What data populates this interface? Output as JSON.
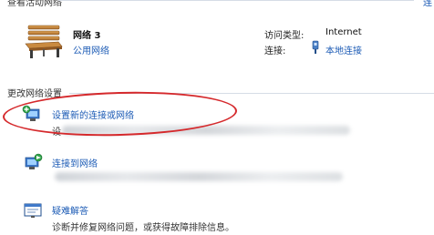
{
  "header": {
    "title": "查看活动网络",
    "right_link": "连"
  },
  "network": {
    "name": "网络  3",
    "type": "公用网络",
    "access_type_label": "访问类型:",
    "access_type_value": "Internet",
    "connections_label": "连接:",
    "connections_value": "本地连接"
  },
  "change_settings": {
    "title": "更改网络设置",
    "tasks": [
      {
        "label": "设置新的连接或网络",
        "desc_prefix": "设"
      },
      {
        "label": "连接到网络"
      },
      {
        "label": "疑难解答",
        "desc": "诊断并修复网络问题，或获得故障排除信息。"
      }
    ]
  },
  "icons": {
    "network": "bench-icon",
    "connection": "network-adapter-icon",
    "task1": "new-connection-icon",
    "task2": "connect-network-icon",
    "task3": "troubleshoot-icon"
  },
  "colors": {
    "link": "#1c5bb5",
    "highlight_ellipse": "#d5292c"
  }
}
